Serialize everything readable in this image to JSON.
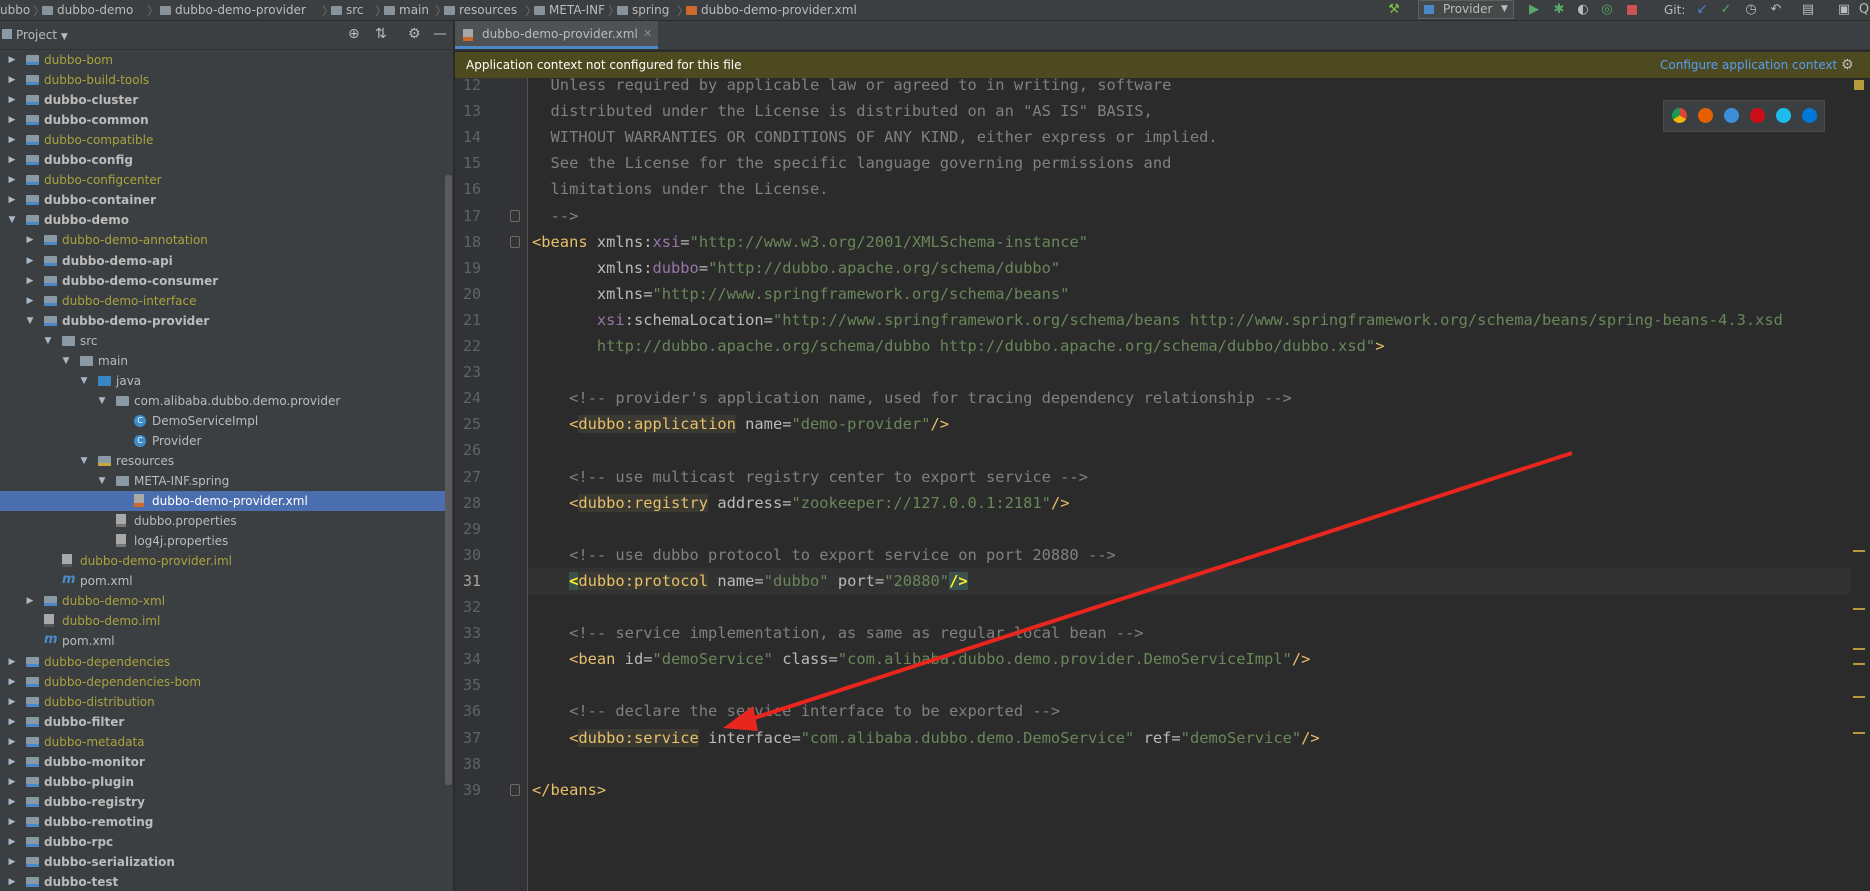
{
  "navbar": {
    "breadcrumbs": [
      "ubbo",
      "dubbo-demo",
      "dubbo-demo-provider",
      "src",
      "main",
      "resources",
      "META-INF",
      "spring",
      "dubbo-demo-provider.xml"
    ],
    "run_config": "Provider",
    "vcs_label": "Git:"
  },
  "project_panel": {
    "title": "Project",
    "tree": [
      {
        "label": "dubbo-bom",
        "style": "olive",
        "depth": 0,
        "arrow": "▶",
        "icon": "mod"
      },
      {
        "label": "dubbo-build-tools",
        "style": "olive",
        "depth": 0,
        "arrow": "▶",
        "icon": "mod"
      },
      {
        "label": "dubbo-cluster",
        "style": "bold",
        "depth": 0,
        "arrow": "▶",
        "icon": "mod"
      },
      {
        "label": "dubbo-common",
        "style": "bold",
        "depth": 0,
        "arrow": "▶",
        "icon": "mod"
      },
      {
        "label": "dubbo-compatible",
        "style": "olive",
        "depth": 0,
        "arrow": "▶",
        "icon": "mod"
      },
      {
        "label": "dubbo-config",
        "style": "bold",
        "depth": 0,
        "arrow": "▶",
        "icon": "mod"
      },
      {
        "label": "dubbo-configcenter",
        "style": "olive",
        "depth": 0,
        "arrow": "▶",
        "icon": "mod"
      },
      {
        "label": "dubbo-container",
        "style": "bold",
        "depth": 0,
        "arrow": "▶",
        "icon": "mod"
      },
      {
        "label": "dubbo-demo",
        "style": "bold",
        "depth": 0,
        "arrow": "▼",
        "icon": "mod"
      },
      {
        "label": "dubbo-demo-annotation",
        "style": "olive",
        "depth": 1,
        "arrow": "▶",
        "icon": "mod"
      },
      {
        "label": "dubbo-demo-api",
        "style": "bold",
        "depth": 1,
        "arrow": "▶",
        "icon": "mod"
      },
      {
        "label": "dubbo-demo-consumer",
        "style": "bold",
        "depth": 1,
        "arrow": "▶",
        "icon": "mod"
      },
      {
        "label": "dubbo-demo-interface",
        "style": "olive",
        "depth": 1,
        "arrow": "▶",
        "icon": "mod"
      },
      {
        "label": "dubbo-demo-provider",
        "style": "bold",
        "depth": 1,
        "arrow": "▼",
        "icon": "mod"
      },
      {
        "label": "src",
        "style": "plain",
        "depth": 2,
        "arrow": "▼",
        "icon": "folder"
      },
      {
        "label": "main",
        "style": "plain",
        "depth": 3,
        "arrow": "▼",
        "icon": "folder"
      },
      {
        "label": "java",
        "style": "plain",
        "depth": 4,
        "arrow": "▼",
        "icon": "src"
      },
      {
        "label": "com.alibaba.dubbo.demo.provider",
        "style": "plain",
        "depth": 5,
        "arrow": "▼",
        "icon": "pkg"
      },
      {
        "label": "DemoServiceImpl",
        "style": "plain",
        "depth": 6,
        "arrow": "",
        "icon": "cls"
      },
      {
        "label": "Provider",
        "style": "plain",
        "depth": 6,
        "arrow": "",
        "icon": "cls"
      },
      {
        "label": "resources",
        "style": "plain",
        "depth": 4,
        "arrow": "▼",
        "icon": "res"
      },
      {
        "label": "META-INF.spring",
        "style": "plain",
        "depth": 5,
        "arrow": "▼",
        "icon": "folder"
      },
      {
        "label": "dubbo-demo-provider.xml",
        "style": "white",
        "depth": 6,
        "arrow": "",
        "icon": "xmlf",
        "selected": true
      },
      {
        "label": "dubbo.properties",
        "style": "plain",
        "depth": 5,
        "arrow": "",
        "icon": "prop"
      },
      {
        "label": "log4j.properties",
        "style": "plain",
        "depth": 5,
        "arrow": "",
        "icon": "prop"
      },
      {
        "label": "dubbo-demo-provider.iml",
        "style": "olive",
        "depth": 2,
        "arrow": "",
        "icon": "iml"
      },
      {
        "label": "pom.xml",
        "style": "plain",
        "depth": 2,
        "arrow": "",
        "icon": "mvn"
      },
      {
        "label": "dubbo-demo-xml",
        "style": "olive",
        "depth": 1,
        "arrow": "▶",
        "icon": "mod"
      },
      {
        "label": "dubbo-demo.iml",
        "style": "olive",
        "depth": 1,
        "arrow": "",
        "icon": "iml"
      },
      {
        "label": "pom.xml",
        "style": "plain",
        "depth": 1,
        "arrow": "",
        "icon": "mvn"
      },
      {
        "label": "dubbo-dependencies",
        "style": "olive",
        "depth": 0,
        "arrow": "▶",
        "icon": "mod"
      },
      {
        "label": "dubbo-dependencies-bom",
        "style": "olive",
        "depth": 0,
        "arrow": "▶",
        "icon": "mod"
      },
      {
        "label": "dubbo-distribution",
        "style": "olive",
        "depth": 0,
        "arrow": "▶",
        "icon": "mod"
      },
      {
        "label": "dubbo-filter",
        "style": "bold",
        "depth": 0,
        "arrow": "▶",
        "icon": "mod"
      },
      {
        "label": "dubbo-metadata",
        "style": "olive",
        "depth": 0,
        "arrow": "▶",
        "icon": "mod"
      },
      {
        "label": "dubbo-monitor",
        "style": "bold",
        "depth": 0,
        "arrow": "▶",
        "icon": "mod"
      },
      {
        "label": "dubbo-plugin",
        "style": "bold",
        "depth": 0,
        "arrow": "▶",
        "icon": "mod"
      },
      {
        "label": "dubbo-registry",
        "style": "bold",
        "depth": 0,
        "arrow": "▶",
        "icon": "mod"
      },
      {
        "label": "dubbo-remoting",
        "style": "bold",
        "depth": 0,
        "arrow": "▶",
        "icon": "mod"
      },
      {
        "label": "dubbo-rpc",
        "style": "bold",
        "depth": 0,
        "arrow": "▶",
        "icon": "mod"
      },
      {
        "label": "dubbo-serialization",
        "style": "bold",
        "depth": 0,
        "arrow": "▶",
        "icon": "mod"
      },
      {
        "label": "dubbo-test",
        "style": "bold",
        "depth": 0,
        "arrow": "▶",
        "icon": "mod"
      }
    ]
  },
  "editor": {
    "tab_label": "dubbo-demo-provider.xml",
    "banner_text": "Application context not configured for this file",
    "banner_link": "Configure application context",
    "current_line": 31,
    "lines": [
      {
        "n": 12,
        "parts": [
          [
            "c",
            "  Unless required by applicable law or agreed to in writing, software"
          ]
        ]
      },
      {
        "n": 13,
        "parts": [
          [
            "c",
            "  distributed under the License is distributed on an \"AS IS\" BASIS,"
          ]
        ]
      },
      {
        "n": 14,
        "parts": [
          [
            "c",
            "  WITHOUT WARRANTIES OR CONDITIONS OF ANY KIND, either express or implied."
          ]
        ]
      },
      {
        "n": 15,
        "parts": [
          [
            "c",
            "  See the License for the specific language governing permissions and"
          ]
        ]
      },
      {
        "n": 16,
        "parts": [
          [
            "c",
            "  limitations under the License."
          ]
        ]
      },
      {
        "n": 17,
        "parts": [
          [
            "c",
            "  -->"
          ]
        ]
      },
      {
        "n": 18,
        "parts": [
          [
            "t",
            "<beans "
          ],
          [
            "a",
            "xmlns:"
          ],
          [
            "n",
            "xsi"
          ],
          [
            "a",
            "="
          ],
          [
            "v",
            "\"http://www.w3.org/2001/XMLSchema-instance\""
          ]
        ]
      },
      {
        "n": 19,
        "parts": [
          [
            "a",
            "       xmlns:"
          ],
          [
            "n",
            "dubbo"
          ],
          [
            "a",
            "="
          ],
          [
            "v",
            "\"http://dubbo.apache.org/schema/dubbo\""
          ]
        ]
      },
      {
        "n": 20,
        "parts": [
          [
            "a",
            "       xmlns="
          ],
          [
            "v",
            "\"http://www.springframework.org/schema/beans\""
          ]
        ]
      },
      {
        "n": 21,
        "parts": [
          [
            "n",
            "       xsi"
          ],
          [
            "a",
            ":schemaLocation="
          ],
          [
            "v",
            "\"http://www.springframework.org/schema/beans http://www.springframework.org/schema/beans/spring-beans-4.3.xsd"
          ]
        ]
      },
      {
        "n": 22,
        "parts": [
          [
            "v",
            "       http://dubbo.apache.org/schema/dubbo http://dubbo.apache.org/schema/dubbo/dubbo.xsd\""
          ],
          [
            "t",
            ">"
          ]
        ]
      },
      {
        "n": 23,
        "parts": []
      },
      {
        "n": 24,
        "parts": [
          [
            "c",
            "    <!-- provider's application name, used for tracing dependency relationship -->"
          ]
        ]
      },
      {
        "n": 25,
        "parts": [
          [
            "t",
            "    <"
          ],
          [
            "h",
            "dubbo:application"
          ],
          [
            "a",
            " name="
          ],
          [
            "v",
            "\"demo-provider\""
          ],
          [
            "t",
            "/>"
          ]
        ]
      },
      {
        "n": 26,
        "parts": []
      },
      {
        "n": 27,
        "parts": [
          [
            "c",
            "    <!-- use multicast registry center to export service -->"
          ]
        ]
      },
      {
        "n": 28,
        "parts": [
          [
            "t",
            "    <"
          ],
          [
            "h",
            "dubbo:registry"
          ],
          [
            "a",
            " address="
          ],
          [
            "v",
            "\"zookeeper://127.0.0.1:2181\""
          ],
          [
            "t",
            "/>"
          ]
        ]
      },
      {
        "n": 29,
        "parts": []
      },
      {
        "n": 30,
        "parts": [
          [
            "c",
            "    <!-- use dubbo protocol to export service on port 20880 -->"
          ]
        ]
      },
      {
        "n": 31,
        "parts": [
          [
            "t",
            "    "
          ],
          [
            "b",
            "<"
          ],
          [
            "h",
            "dubbo:protocol"
          ],
          [
            "a",
            " name="
          ],
          [
            "v",
            "\"dubbo\""
          ],
          [
            "a",
            " port="
          ],
          [
            "v",
            "\"20880\""
          ],
          [
            "b",
            "/>"
          ]
        ]
      },
      {
        "n": 32,
        "parts": []
      },
      {
        "n": 33,
        "parts": [
          [
            "c",
            "    <!-- service implementation, as same as regular local bean -->"
          ]
        ]
      },
      {
        "n": 34,
        "parts": [
          [
            "t",
            "    <bean "
          ],
          [
            "a",
            "id="
          ],
          [
            "v",
            "\"demoService\""
          ],
          [
            "a",
            " class="
          ],
          [
            "v",
            "\"com.alibaba.dubbo.demo.provider.DemoServiceImpl\""
          ],
          [
            "t",
            "/>"
          ]
        ]
      },
      {
        "n": 35,
        "parts": []
      },
      {
        "n": 36,
        "parts": [
          [
            "c",
            "    <!-- declare the service interface to be exported -->"
          ]
        ]
      },
      {
        "n": 37,
        "parts": [
          [
            "t",
            "    <"
          ],
          [
            "h",
            "dubbo:service"
          ],
          [
            "a",
            " interface="
          ],
          [
            "v",
            "\"com.alibaba.dubbo.demo.DemoService\""
          ],
          [
            "a",
            " ref="
          ],
          [
            "v",
            "\"demoService\""
          ],
          [
            "t",
            "/>"
          ]
        ]
      },
      {
        "n": 38,
        "parts": []
      },
      {
        "n": 39,
        "parts": [
          [
            "t",
            "</beans>"
          ]
        ]
      }
    ]
  },
  "colors": {
    "annotation_arrow": "#e8261e",
    "selection": "#4b6eaf",
    "banner": "#4e4a1f"
  },
  "icons": [
    "build-hammer-icon",
    "run-icon",
    "debug-icon",
    "coverage-icon",
    "profile-icon",
    "stop-icon",
    "vcs-update-icon",
    "vcs-commit-icon",
    "history-icon",
    "revert-icon",
    "project-structure-icon",
    "gear-icon",
    "crosshair-icon",
    "collapse-icon",
    "minimize-icon",
    "chrome-icon",
    "firefox-icon",
    "safari-icon",
    "opera-icon",
    "ie-icon",
    "edge-icon"
  ]
}
